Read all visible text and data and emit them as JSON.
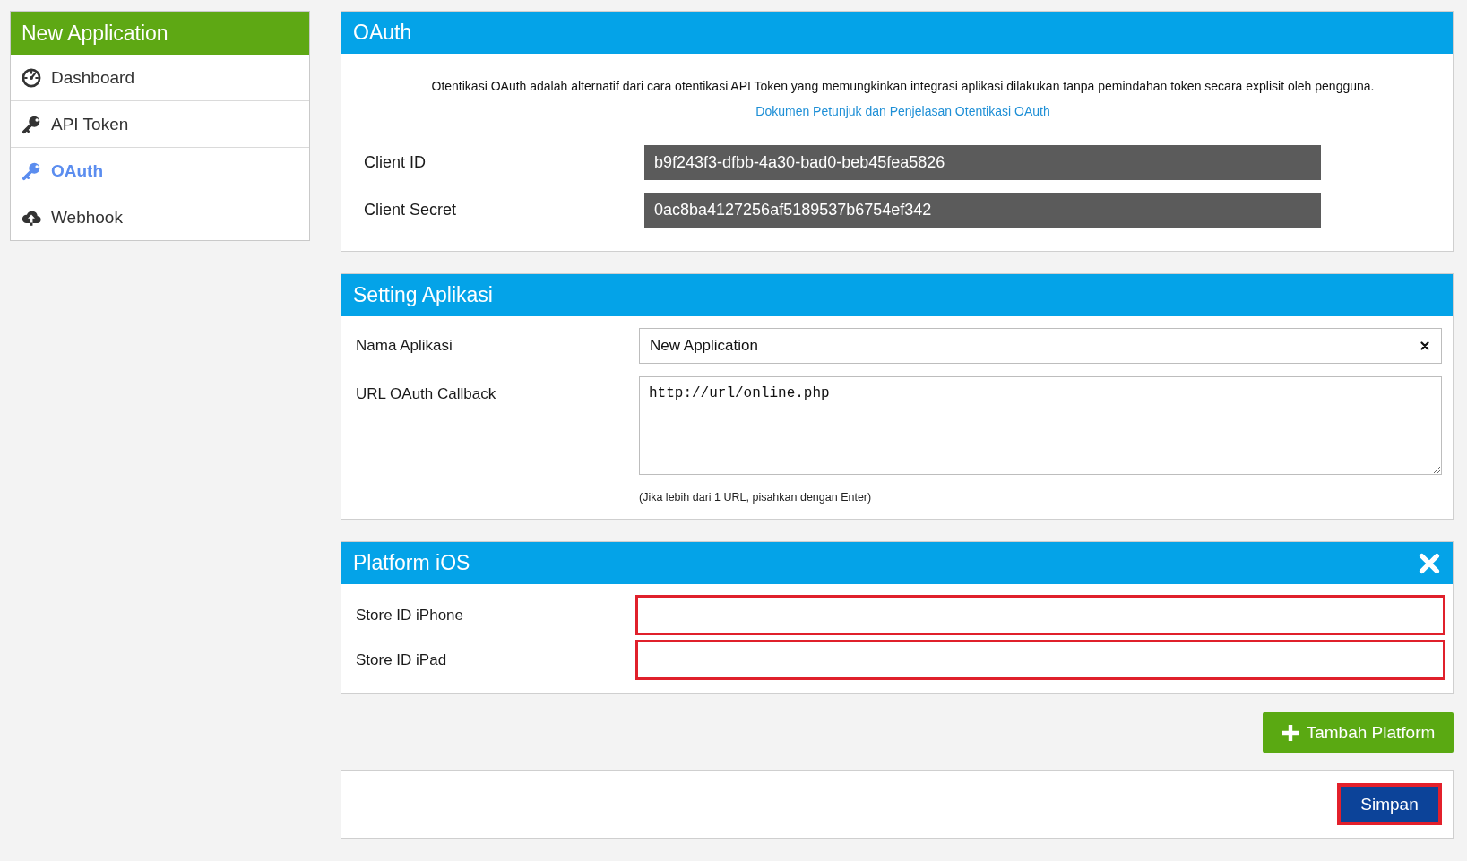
{
  "sidebar": {
    "title": "New Application",
    "items": [
      {
        "label": "Dashboard",
        "selected": false
      },
      {
        "label": "API Token",
        "selected": false
      },
      {
        "label": "OAuth",
        "selected": true
      },
      {
        "label": "Webhook",
        "selected": false
      }
    ]
  },
  "oauth_panel": {
    "title": "OAuth",
    "description": "Otentikasi OAuth adalah alternatif dari cara otentikasi API Token yang memungkinkan integrasi aplikasi dilakukan tanpa pemindahan token secara explisit oleh pengguna.",
    "link": "Dokumen Petunjuk dan Penjelasan Otentikasi OAuth",
    "fields": [
      {
        "label": "Client ID",
        "value": "b9f243f3-dfbb-4a30-bad0-beb45fea5826"
      },
      {
        "label": "Client Secret",
        "value": "0ac8ba4127256af5189537b6754ef342"
      }
    ]
  },
  "settings_panel": {
    "title": "Setting Aplikasi",
    "fields": [
      {
        "kind": "text",
        "label": "Nama Aplikasi",
        "value": "New Application"
      },
      {
        "kind": "textarea",
        "label": "URL OAuth Callback",
        "value": "http://url/online.php",
        "hint": "(Jika lebih dari 1 URL, pisahkan dengan Enter)"
      }
    ]
  },
  "platform_panel": {
    "title": "Platform iOS",
    "fields": [
      {
        "label": "Store ID iPhone",
        "highlighted": true
      },
      {
        "label": "Store ID iPad",
        "highlighted": true
      }
    ]
  },
  "add_platform_button": "Tambah Platform",
  "save_button": {
    "label": "Simpan",
    "highlighted": true
  }
}
